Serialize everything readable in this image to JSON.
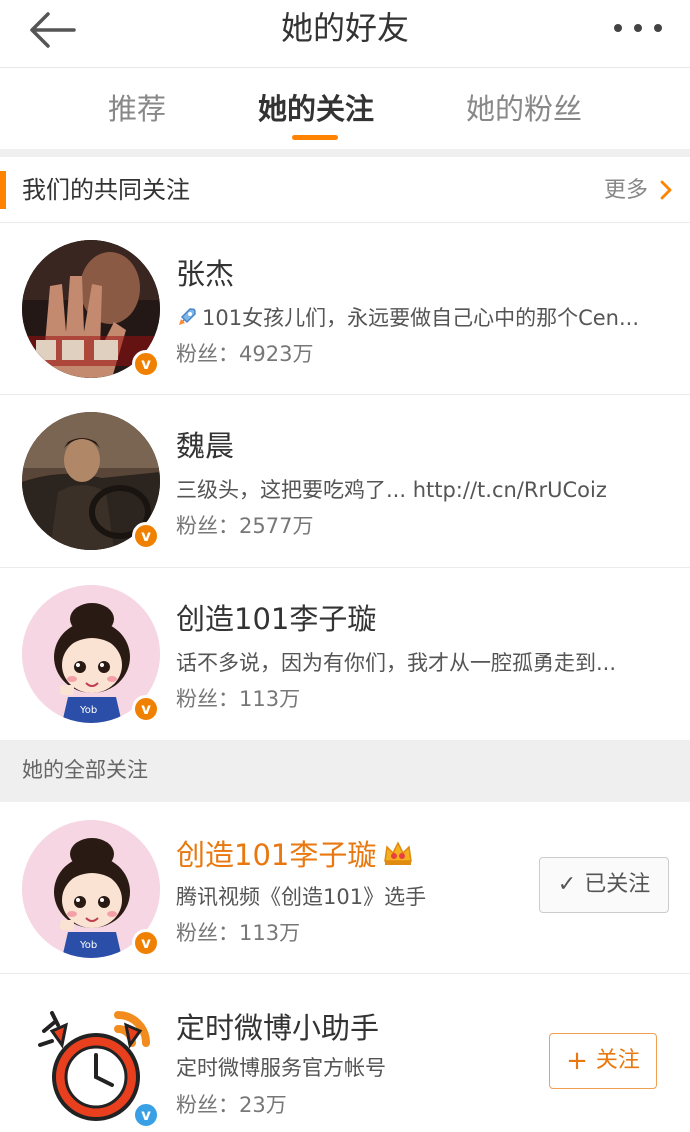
{
  "header": {
    "title": "她的好友"
  },
  "tabs": [
    {
      "label": "推荐"
    },
    {
      "label": "她的关注"
    },
    {
      "label": "她的粉丝"
    }
  ],
  "common_section": {
    "title": "我们的共同关注",
    "more": "更多"
  },
  "common_users": [
    {
      "name": "张杰",
      "desc": "101女孩儿们，永远要做自己心中的那个Cen...",
      "fans": "粉丝：4923万",
      "avatar": "poster-avatar"
    },
    {
      "name": "魏晨",
      "desc": "三级头，这把要吃鸡了... http://t.cn/RrUCoiz",
      "fans": "粉丝：2577万",
      "avatar": "car-avatar"
    },
    {
      "name": "创造101李子璇",
      "desc": "话不多说，因为有你们，我才从一腔孤勇走到...",
      "fans": "粉丝：113万",
      "avatar": "cartoon-girl-avatar"
    }
  ],
  "all_section": {
    "title": "她的全部关注"
  },
  "all_users": [
    {
      "name": "创造101李子璇",
      "desc": "腾讯视频《创造101》选手",
      "fans": "粉丝：113万",
      "button": "已关注",
      "avatar": "cartoon-girl-avatar"
    },
    {
      "name": "定时微博小助手",
      "desc": "定时微博服务官方帐号",
      "fans": "粉丝：23万",
      "button": "关注",
      "avatar": "alarm-clock-avatar"
    }
  ],
  "colors": {
    "accent": "#ff8200",
    "verified_orange": "#f08000",
    "verified_blue": "#3aa0e6"
  }
}
